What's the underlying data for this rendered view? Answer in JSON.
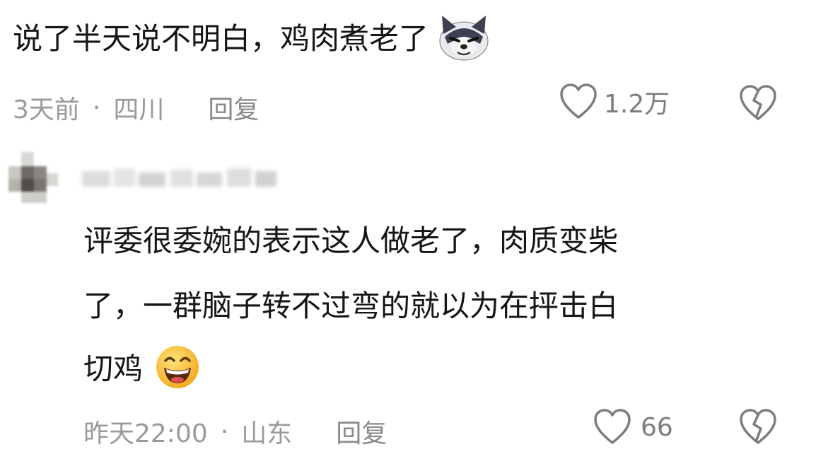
{
  "comment1": {
    "text": "说了半天说不明白，鸡肉煮老了",
    "emoji": "sly-cat-emoji",
    "time": "3天前",
    "dot": "·",
    "location": "四川",
    "reply_label": "回复",
    "likes": "1.2万"
  },
  "reply1": {
    "line1": "评委很委婉的表示这人做老了，肉质变柴",
    "line2": "了，一群脑子转不过弯的就以为在抨击白",
    "line3": "切鸡",
    "emoji": "grinning-face-emoji",
    "time": "昨天22:00",
    "dot": "·",
    "location": "山东",
    "reply_label": "回复",
    "likes": "66"
  },
  "colors": {
    "text": "#161616",
    "meta": "#9a9a9a",
    "icon": "#7d7d7d"
  }
}
